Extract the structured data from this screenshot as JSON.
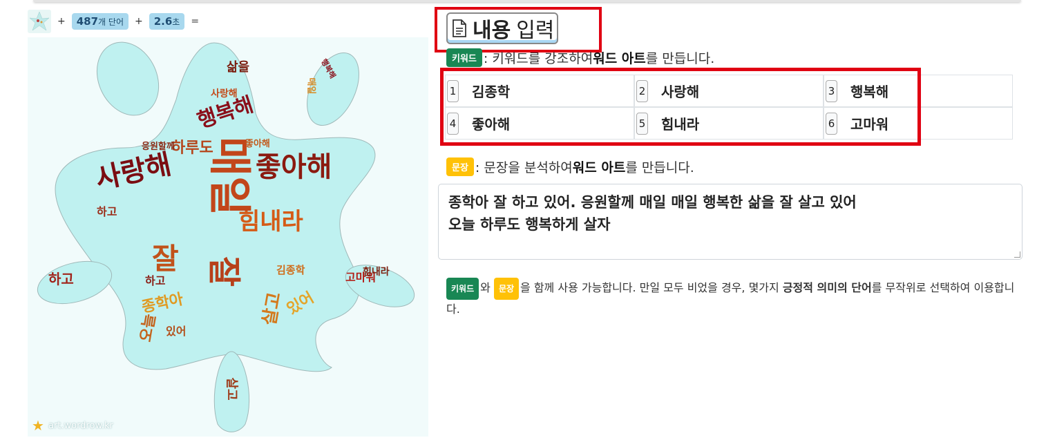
{
  "stats": {
    "word_count_value": "487",
    "word_count_unit": "개 단어",
    "time_value": "2.6",
    "time_unit": "초",
    "plus": "+",
    "equals": "="
  },
  "wordart": {
    "watermark": "art.wordrow.kr",
    "shape_color": "#bff1f0",
    "words": [
      {
        "text": "사랑해",
        "color": "#7b0d12"
      },
      {
        "text": "좋아해",
        "color": "#8b1a10"
      },
      {
        "text": "힘내라",
        "color": "#d55b16"
      },
      {
        "text": "행복해",
        "color": "#8a0f1a"
      },
      {
        "text": "하루도",
        "color": "#b5451b"
      },
      {
        "text": "잘",
        "color": "#c1521a"
      },
      {
        "text": "매일",
        "color": "#c2461a"
      },
      {
        "text": "종학아",
        "color": "#e09a22"
      },
      {
        "text": "삶을",
        "color": "#7a1b0c"
      },
      {
        "text": "살고",
        "color": "#d4791c"
      },
      {
        "text": "있어",
        "color": "#e4a52a"
      },
      {
        "text": "하고",
        "color": "#a0231a"
      },
      {
        "text": "오늘",
        "color": "#c4621b"
      },
      {
        "text": "응원할께",
        "color": "#8c2b16"
      },
      {
        "text": "고마워",
        "color": "#b31e17"
      },
      {
        "text": "김종학",
        "color": "#d06d1a"
      }
    ]
  },
  "editor": {
    "title_bold": "내용",
    "title_rest": "입력",
    "keyword_badge": "키워드",
    "keyword_hint_pre": ": 키워드를 강조하여 ",
    "keyword_hint_bold": "워드 아트",
    "keyword_hint_post": "를 만듭니다.",
    "keywords": [
      {
        "num": "1",
        "value": "김종학"
      },
      {
        "num": "2",
        "value": "사랑해"
      },
      {
        "num": "3",
        "value": "행복해"
      },
      {
        "num": "4",
        "value": "좋아해"
      },
      {
        "num": "5",
        "value": "힘내라"
      },
      {
        "num": "6",
        "value": "고마워"
      }
    ],
    "sentence_badge": "문장",
    "sentence_hint_pre": ": 문장을 분석하여 ",
    "sentence_hint_bold": "워드 아트",
    "sentence_hint_post": "를 만듭니다.",
    "sentence_line1": "종학아 잘 하고 있어. 응원할께  매일 매일 행복한 삶을 잘 살고 있어",
    "sentence_line2": "오늘 하루도 행복하게 살자",
    "note_mid1": "와 ",
    "note_mid2": "을 함께 사용 가능합니다. 만일 모두 비었을 경우, 몇가지 ",
    "note_bold": "긍정적 의미의 단어",
    "note_end": "를 무작위로 선택하여 이용합니다."
  },
  "colors": {
    "highlight_red": "#e00012",
    "badge_green": "#198754",
    "badge_yellow": "#ffc107",
    "pill_blue": "#a8d8ee"
  }
}
